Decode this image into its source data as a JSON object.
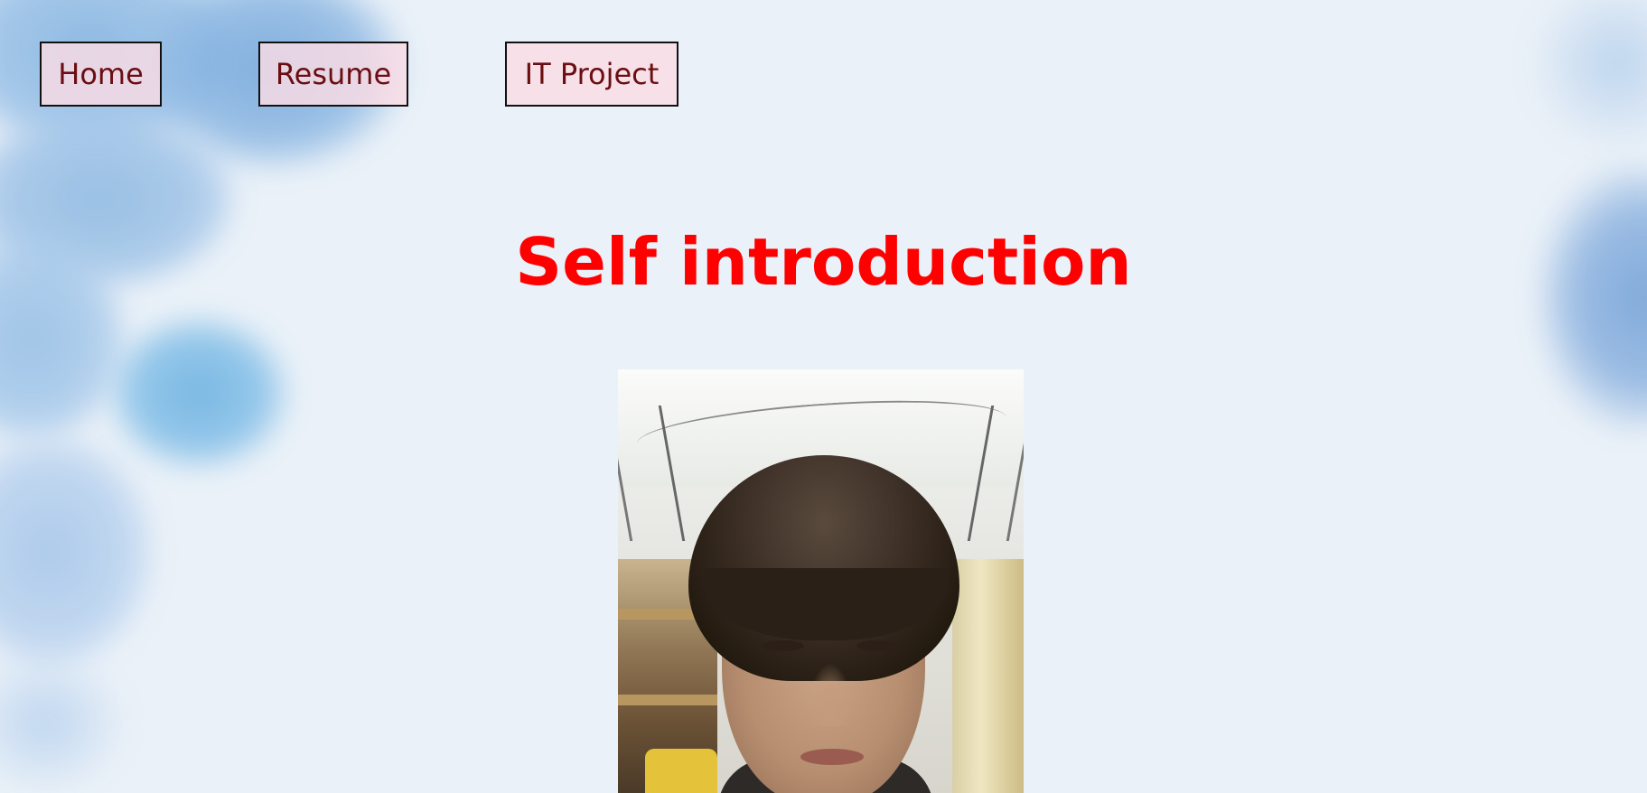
{
  "nav": {
    "home_label": "Home",
    "resume_label": "Resume",
    "project_label": "IT Project"
  },
  "main": {
    "title": "Self introduction"
  },
  "colors": {
    "background": "#eaf1f8",
    "title": "#ff0000",
    "nav_text": "#6b0e12",
    "nav_fill": "#fadce4",
    "nav_border": "#111111"
  }
}
